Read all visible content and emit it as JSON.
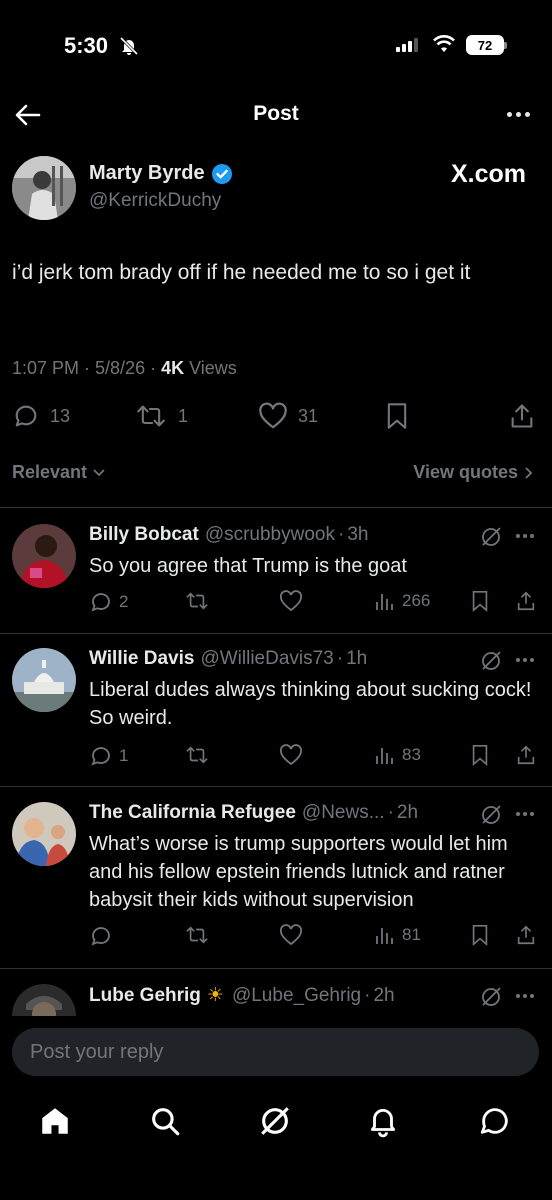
{
  "status_bar": {
    "time": "5:30",
    "battery": "72"
  },
  "header": {
    "title": "Post"
  },
  "post": {
    "author_name": "Marty Byrde",
    "author_handle": "@KerrickDuchy",
    "source_badge": "X.com",
    "text": "i’d jerk tom brady off if he needed me to so i get it",
    "timestamp": "1:07 PM · 5/8/26 · ",
    "views_count": "4K",
    "views_label": " Views",
    "replies": "13",
    "reposts": "1",
    "likes": "31"
  },
  "sort": {
    "label": "Relevant",
    "view_quotes": "View quotes"
  },
  "replies": [
    {
      "name": "Billy Bobcat",
      "handle": "@scrubbywook",
      "time": "3h",
      "text": "So you agree that Trump is the goat",
      "replies": "2",
      "views": "266"
    },
    {
      "name": "Willie Davis",
      "handle": "@WillieDavis73",
      "time": "1h",
      "text": "Liberal dudes always thinking about sucking cock! So weird.",
      "replies": "1",
      "views": "83"
    },
    {
      "name": "The California Refugee",
      "handle": "@News...",
      "time": "2h",
      "text": "What’s worse is trump supporters would let him and his fellow epstein friends lutnick and ratner babysit their kids without supervision",
      "views": "81"
    },
    {
      "name": "Lube Gehrig",
      "emoji": "☀",
      "handle": "@Lube_Gehrig",
      "time": "2h"
    }
  ],
  "composer": {
    "placeholder": "Post your reply"
  },
  "colors": {
    "background": "#000000",
    "text": "#e7e9ea",
    "muted": "#71767b",
    "verified": "#1d9bf0",
    "divider": "#2f3336"
  }
}
